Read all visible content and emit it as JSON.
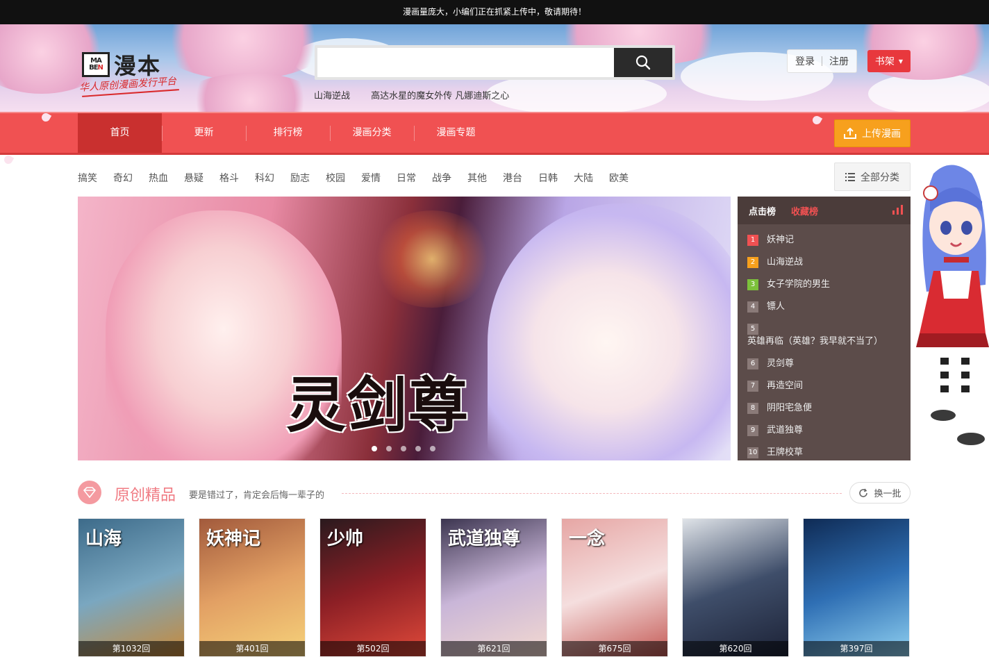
{
  "notice": "漫画量庞大，小编们正在抓紧上传中，敬请期待！",
  "header": {
    "logo_box_top": "MA",
    "logo_box_mid": "BE",
    "logo_box_letter": "N",
    "logo_text": "漫本",
    "slogan": "华人原创漫画发行平台",
    "search_placeholder": "",
    "hot_words": [
      "山海逆战",
      "高达水星的魔女外传 凡娜迪斯之心"
    ],
    "login": "登录",
    "register": "注册",
    "shelf": "书架"
  },
  "nav": {
    "items": [
      "首页",
      "更新",
      "排行榜",
      "漫画分类",
      "漫画专题"
    ],
    "upload": "上传漫画"
  },
  "categories": [
    "搞笑",
    "奇幻",
    "热血",
    "悬疑",
    "格斗",
    "科幻",
    "励志",
    "校园",
    "爱情",
    "日常",
    "战争",
    "其他",
    "港台",
    "日韩",
    "大陆",
    "欧美"
  ],
  "all_categories": "全部分类",
  "hero": {
    "title": "灵剑尊",
    "slides": 5,
    "active_slide": 1
  },
  "ranking": {
    "tab_active": "点击榜",
    "tab_other": "收藏榜",
    "items": [
      {
        "n": "1",
        "title": "妖神记"
      },
      {
        "n": "2",
        "title": "山海逆战"
      },
      {
        "n": "3",
        "title": "女子学院的男生"
      },
      {
        "n": "4",
        "title": "镖人"
      },
      {
        "n": "5",
        "title": "英雄再临（英雄？我早就不当了）"
      },
      {
        "n": "6",
        "title": "灵剑尊"
      },
      {
        "n": "7",
        "title": "再造空间"
      },
      {
        "n": "8",
        "title": "阴阳宅急便"
      },
      {
        "n": "9",
        "title": "武道独尊"
      },
      {
        "n": "10",
        "title": "王牌校草"
      }
    ]
  },
  "section": {
    "title": "原创精品",
    "subtitle": "要是错过了，肯定会后悔一辈子的",
    "refresh": "换一批"
  },
  "cards": [
    {
      "cover_text": "山海",
      "ep": "第1032回",
      "colors": [
        "#3d6b8a",
        "#7aa7c0",
        "#c88a3a"
      ]
    },
    {
      "cover_text": "妖神记",
      "ep": "第401回",
      "colors": [
        "#a25a3c",
        "#e2a064",
        "#f6d27a"
      ]
    },
    {
      "cover_text": "少帅",
      "ep": "第502回",
      "colors": [
        "#2a1a1e",
        "#8c1f25",
        "#e04a3a"
      ]
    },
    {
      "cover_text": "武道独尊",
      "ep": "第621回",
      "colors": [
        "#3c3550",
        "#c9b6d8",
        "#f3d9d0"
      ]
    },
    {
      "cover_text": "一念",
      "ep": "第675回",
      "colors": [
        "#e6a6a4",
        "#f5dede",
        "#c45a55"
      ]
    },
    {
      "cover_text": "",
      "ep": "第620回",
      "colors": [
        "#dfe3e8",
        "#3f4e6a",
        "#1c2236"
      ]
    },
    {
      "cover_text": "",
      "ep": "第397回",
      "colors": [
        "#0f2b55",
        "#2f6fb4",
        "#8fd0f0"
      ]
    }
  ]
}
